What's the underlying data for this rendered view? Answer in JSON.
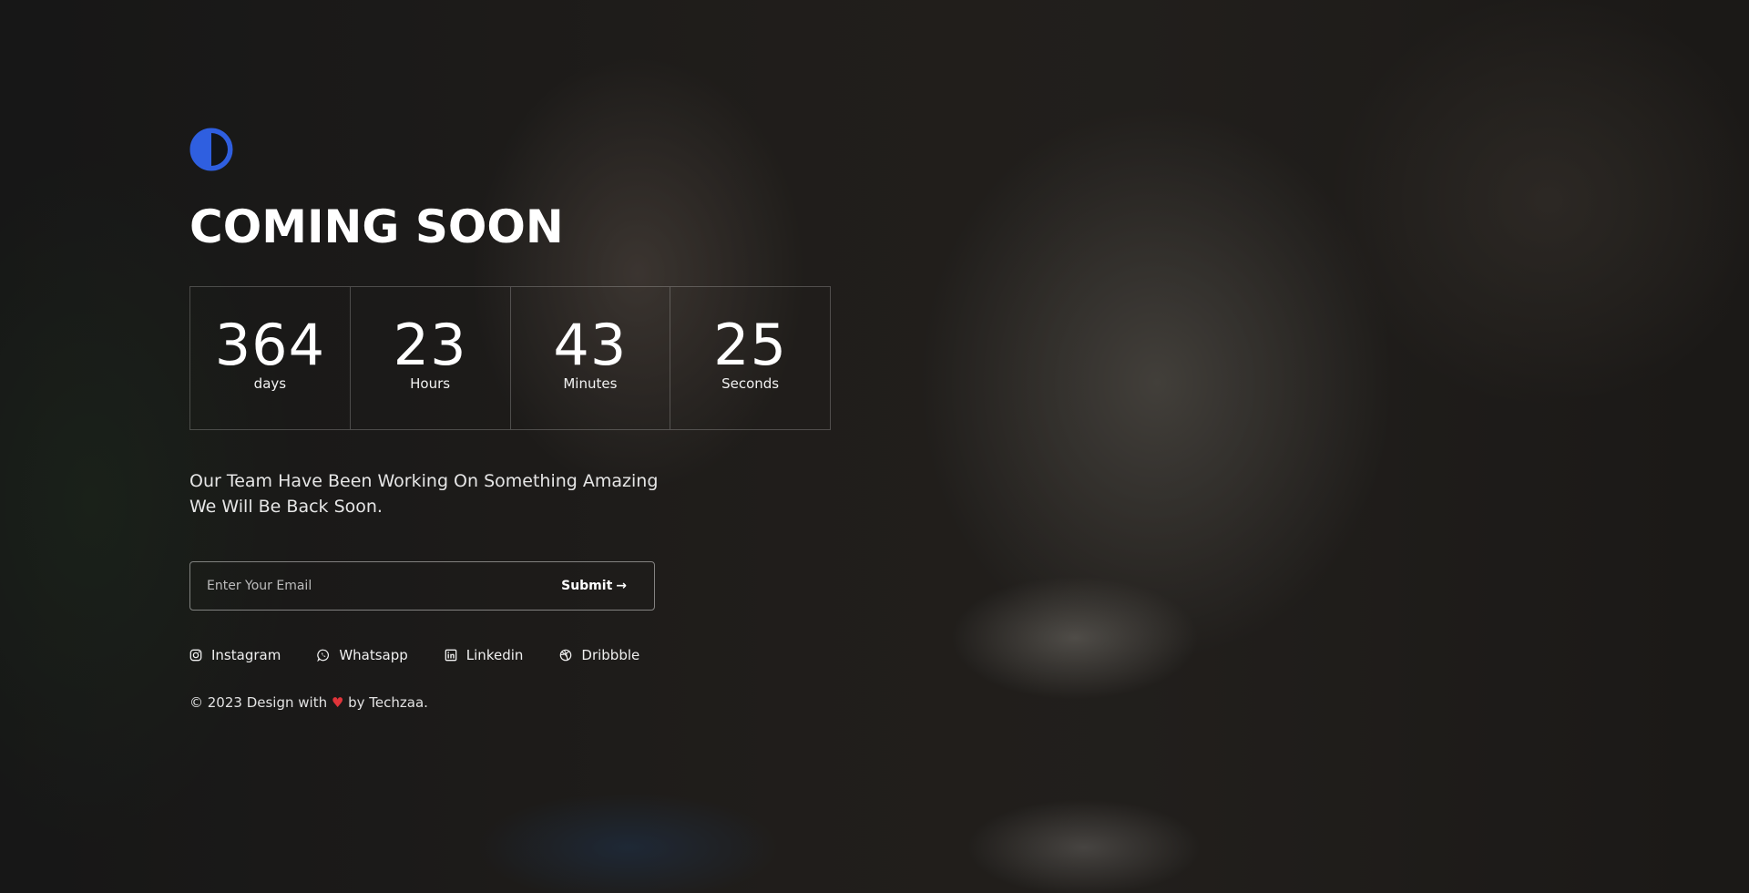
{
  "page": {
    "title": "COMING SOON"
  },
  "countdown": [
    {
      "value": "364",
      "unit": "days"
    },
    {
      "value": "23",
      "unit": "Hours"
    },
    {
      "value": "43",
      "unit": "Minutes"
    },
    {
      "value": "25",
      "unit": "Seconds"
    }
  ],
  "description": {
    "line1": "Our Team Have Been Working On Something Amazing",
    "line2": "We Will Be Back Soon."
  },
  "form": {
    "email_placeholder": "Enter Your Email",
    "submit_label": "Submit",
    "submit_arrow": "→"
  },
  "social": [
    {
      "label": "Instagram",
      "icon": "instagram-icon"
    },
    {
      "label": "Whatsapp",
      "icon": "whatsapp-icon"
    },
    {
      "label": "Linkedin",
      "icon": "linkedin-icon"
    },
    {
      "label": "Dribbble",
      "icon": "dribbble-icon"
    }
  ],
  "footer": {
    "prefix": "© 2023 Design with",
    "heart": "♥",
    "suffix": "by Techzaa."
  },
  "colors": {
    "logo_blue": "#2f5fe0",
    "heart_red": "#e0343a"
  }
}
